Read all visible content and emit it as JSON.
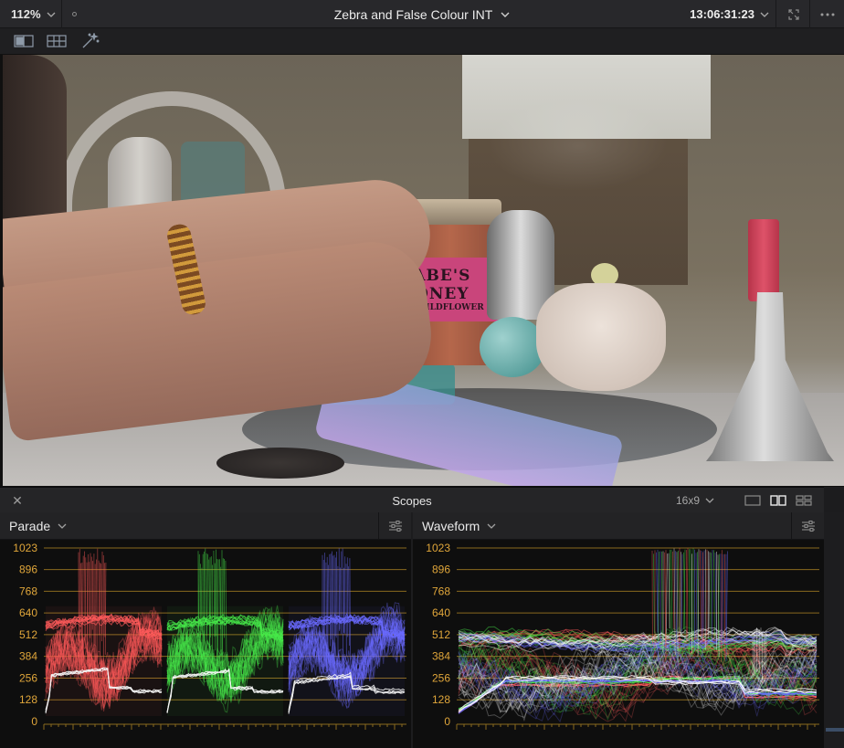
{
  "title_bar": {
    "zoom": "112%",
    "clip_title": "Zebra and False Colour INT",
    "timecode": "13:06:31:23"
  },
  "viewer": {
    "jar_label_line1": "BABE'S HONEY",
    "jar_label_line2": "WILDFLOWER"
  },
  "scopes": {
    "title": "Scopes",
    "aspect": "16x9",
    "left_scope": "Parade",
    "right_scope": "Waveform"
  },
  "colors": {
    "scale_label": "#e0a63a",
    "grid_line": "#8a6a1f",
    "red_channel": "#ff5a5a",
    "green_channel": "#47ea4a",
    "blue_channel": "#6a6aff"
  },
  "scale_ticks": [
    "1023",
    "896",
    "768",
    "640",
    "512",
    "384",
    "256",
    "128",
    "0"
  ]
}
